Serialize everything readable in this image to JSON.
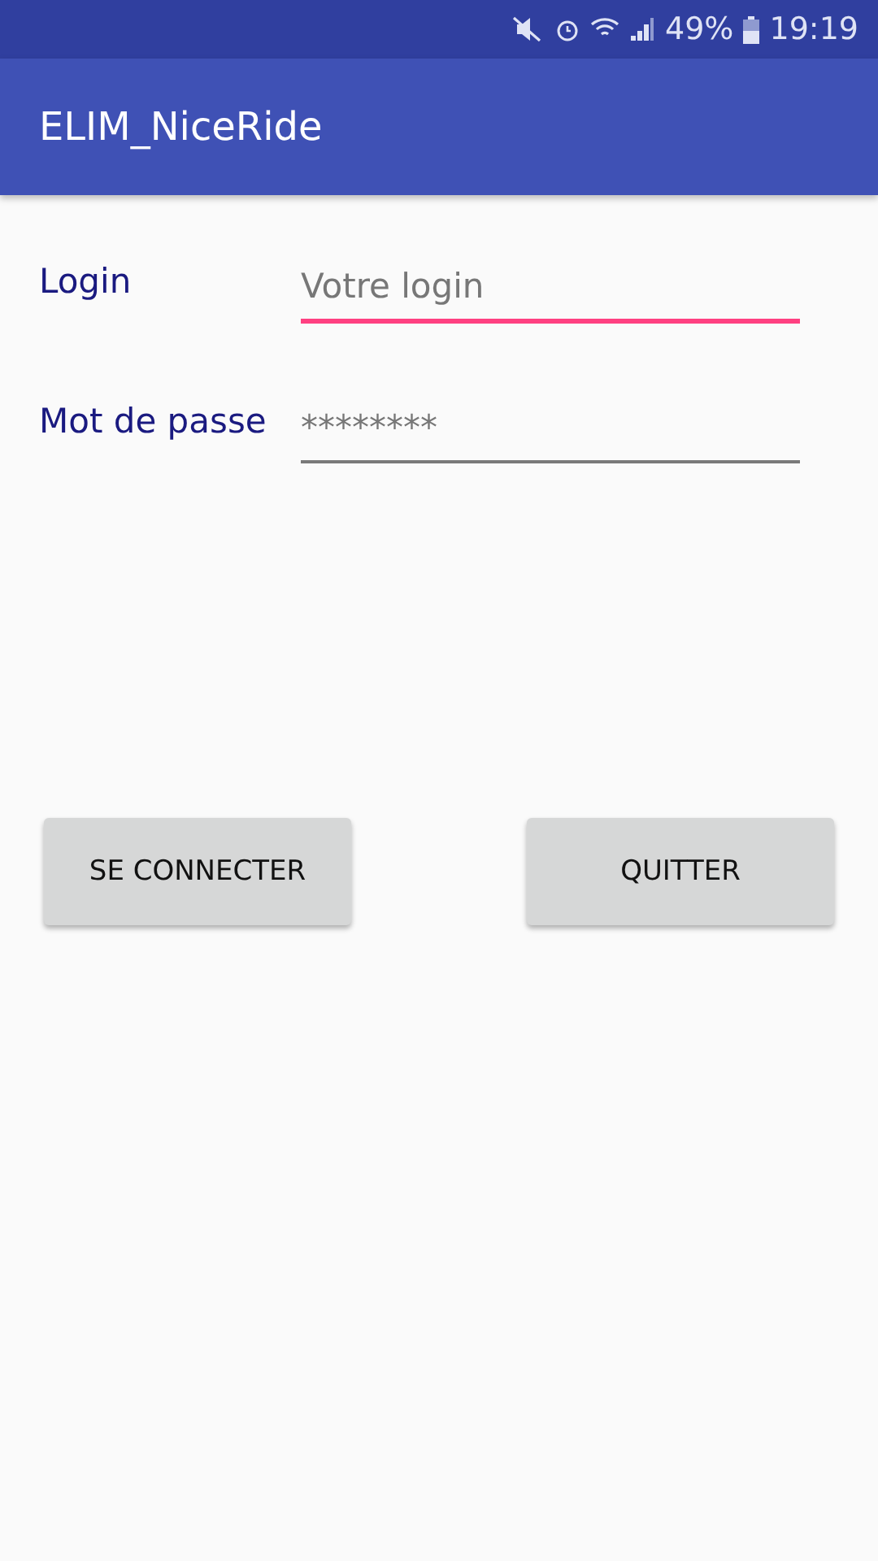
{
  "status_bar": {
    "battery": "49%",
    "time": "19:19"
  },
  "app_bar": {
    "title": "ELIM_NiceRide"
  },
  "fields": [
    {
      "label": "Login",
      "placeholder": "Votre login",
      "focused": true
    },
    {
      "label": "Mot de passe",
      "placeholder": "********",
      "focused": false
    }
  ],
  "buttons": [
    "SE CONNECTER",
    "QUITTER"
  ]
}
